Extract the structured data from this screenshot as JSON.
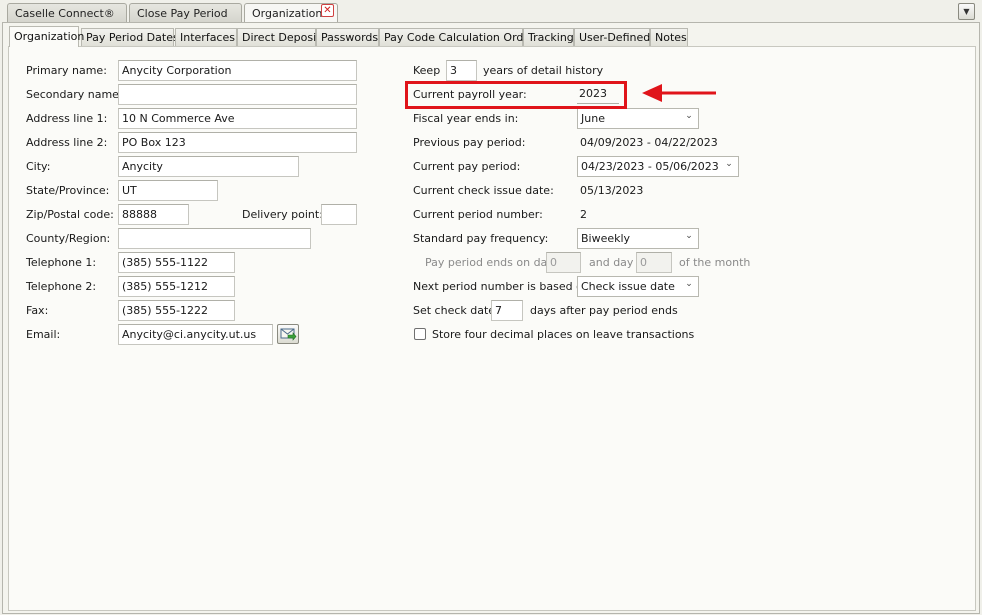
{
  "doc_tabs": [
    {
      "label": "Caselle Connect®"
    },
    {
      "label": "Close Pay Period"
    },
    {
      "label": "Organization",
      "active": true
    }
  ],
  "inner_tabs": [
    {
      "label": "Organization",
      "active": true
    },
    {
      "label": "Pay Period Dates"
    },
    {
      "label": "Interfaces"
    },
    {
      "label": "Direct Deposit"
    },
    {
      "label": "Passwords"
    },
    {
      "label": "Pay Code Calculation Order"
    },
    {
      "label": "Tracking"
    },
    {
      "label": "User-Defined"
    },
    {
      "label": "Notes"
    }
  ],
  "left": {
    "primary_name": {
      "label": "Primary name:",
      "value": "Anycity Corporation"
    },
    "secondary_name": {
      "label": "Secondary name:",
      "value": ""
    },
    "address1": {
      "label": "Address line 1:",
      "value": "10 N Commerce Ave"
    },
    "address2": {
      "label": "Address line 2:",
      "value": "PO Box 123"
    },
    "city": {
      "label": "City:",
      "value": "Anycity"
    },
    "state": {
      "label": "State/Province:",
      "value": "UT"
    },
    "zip": {
      "label": "Zip/Postal code:",
      "value": "88888"
    },
    "delivery_point": {
      "label": "Delivery point:",
      "value": ""
    },
    "county": {
      "label": "County/Region:",
      "value": ""
    },
    "telephone1": {
      "label": "Telephone 1:",
      "value": "(385) 555-1122"
    },
    "telephone2": {
      "label": "Telephone 2:",
      "value": "(385) 555-1212"
    },
    "fax": {
      "label": "Fax:",
      "value": "(385) 555-1222"
    },
    "email": {
      "label": "Email:",
      "value": "Anycity@ci.anycity.ut.us"
    }
  },
  "right": {
    "keep_label": "Keep",
    "keep_value": "3",
    "keep_suffix": "years of detail history",
    "payroll_year_label": "Current payroll year:",
    "payroll_year_value": "2023",
    "fiscal_label": "Fiscal year ends in:",
    "fiscal_value": "June",
    "prev_period_label": "Previous pay period:",
    "prev_period_value": "04/09/2023 - 04/22/2023",
    "cur_period_label": "Current pay period:",
    "cur_period_value": "04/23/2023 - 05/06/2023",
    "check_date_label": "Current check issue date:",
    "check_date_value": "05/13/2023",
    "period_number_label": "Current period number:",
    "period_number_value": "2",
    "frequency_label": "Standard pay frequency:",
    "frequency_value": "Biweekly",
    "ends_on_day_label": "Pay period ends on day",
    "ends_on_day_value": "0",
    "and_day_label": "and day",
    "and_day_value": "0",
    "of_month_label": "of the month",
    "next_period_label": "Next period number is based on:",
    "next_period_value": "Check issue date",
    "set_check_label": "Set check date",
    "set_check_value": "7",
    "set_check_suffix": "days after pay period ends",
    "store_decimals_label": "Store four decimal places on leave transactions"
  },
  "colors": {
    "highlight": "#e0141a",
    "arrow": "#e0141a"
  }
}
